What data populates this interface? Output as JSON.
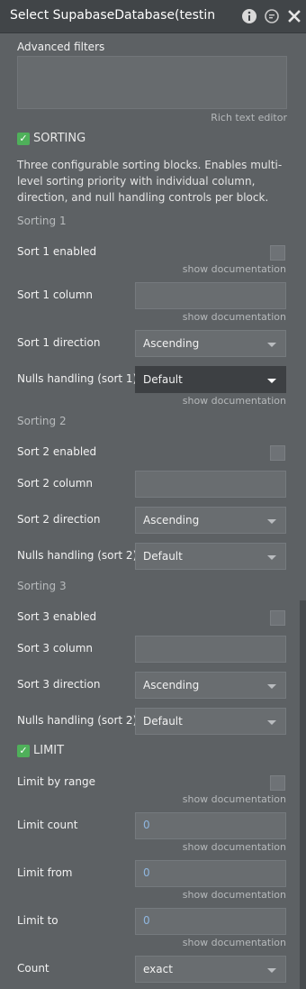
{
  "titlebar": {
    "title": "Select SupabaseDatabase(testin",
    "icons": [
      "info-icon",
      "comment-icon",
      "close-icon"
    ]
  },
  "advanced_filters": {
    "label": "Advanced filters",
    "caption": "Rich text editor"
  },
  "sorting": {
    "heading": "SORTING",
    "description": "Three configurable sorting blocks. Enables multi-level sorting priority with individual column, direction, and null handling controls per block.",
    "blocks": [
      {
        "group": "Sorting 1",
        "enabled_label": "Sort 1 enabled",
        "column_label": "Sort 1 column",
        "direction_label": "Sort 1 direction",
        "direction_value": "Ascending",
        "nulls_label": "Nulls handling (sort 1)",
        "nulls_value": "Default"
      },
      {
        "group": "Sorting 2",
        "enabled_label": "Sort 2 enabled",
        "column_label": "Sort 2 column",
        "direction_label": "Sort 2 direction",
        "direction_value": "Ascending",
        "nulls_label": "Nulls handling (sort 2)",
        "nulls_value": "Default"
      },
      {
        "group": "Sorting 3",
        "enabled_label": "Sort 3 enabled",
        "column_label": "Sort 3 column",
        "direction_label": "Sort 3 direction",
        "direction_value": "Ascending",
        "nulls_label": "Nulls handling (sort 2)",
        "nulls_value": "Default"
      }
    ]
  },
  "limit": {
    "heading": "LIMIT",
    "range_label": "Limit by range",
    "count_label": "Limit count",
    "count_value": "0",
    "from_label": "Limit from",
    "from_value": "0",
    "to_label": "Limit to",
    "to_value": "0",
    "count_mode_label": "Count",
    "count_mode_value": "exact"
  },
  "doc_link": "show documentation",
  "colors": {
    "panel_bg": "#5d6164",
    "titlebar_bg": "#414548",
    "check_green": "#4fb05a",
    "value_blue": "#8fb6df"
  }
}
